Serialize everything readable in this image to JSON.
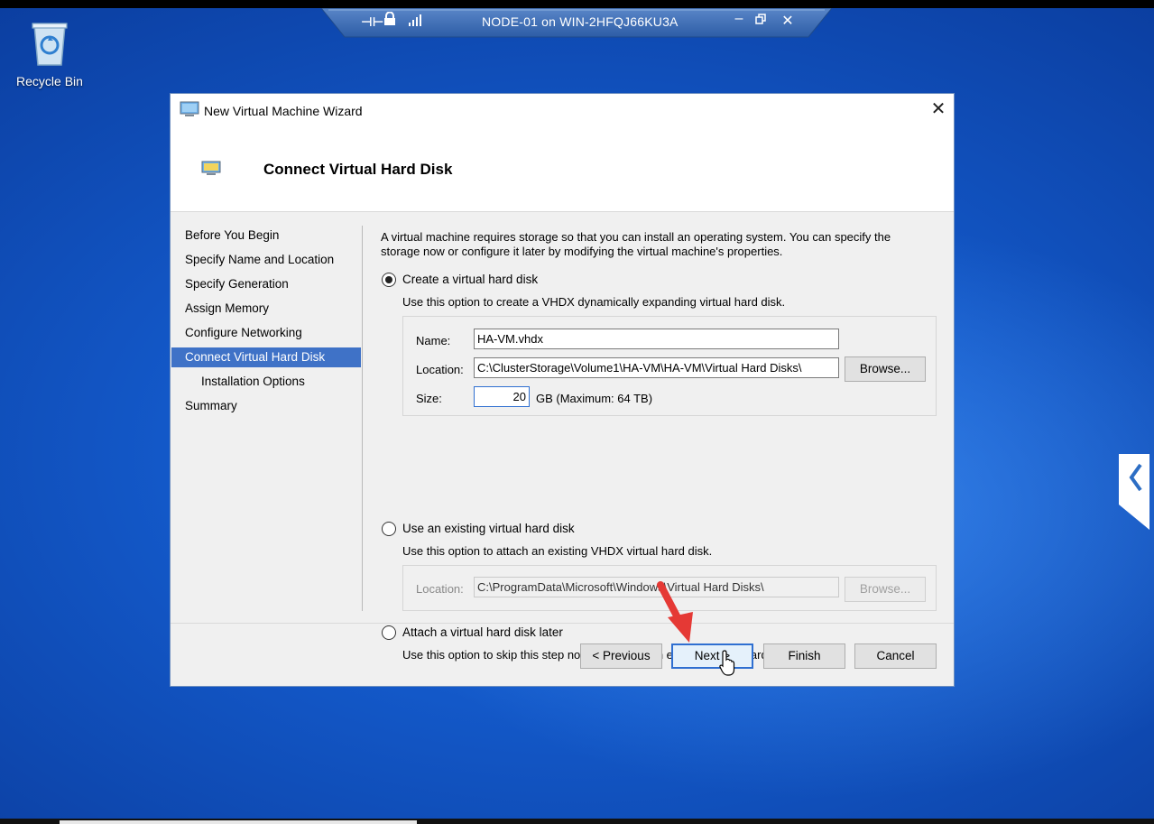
{
  "desktop": {
    "recycle_bin_label": "Recycle Bin"
  },
  "rdp_bar": {
    "title": "NODE-01 on WIN-2HFQJ66KU3A",
    "pin_glyph": "⊣⊢",
    "minimize_glyph": "–",
    "close_glyph": "✕"
  },
  "wizard": {
    "title": "New Virtual Machine Wizard",
    "close_glyph": "✕",
    "header_title": "Connect Virtual Hard Disk",
    "nav": [
      {
        "label": "Before You Begin"
      },
      {
        "label": "Specify Name and Location"
      },
      {
        "label": "Specify Generation"
      },
      {
        "label": "Assign Memory"
      },
      {
        "label": "Configure Networking"
      },
      {
        "label": "Connect Virtual Hard Disk",
        "selected": true
      },
      {
        "label": "Installation Options",
        "sub": true
      },
      {
        "label": "Summary"
      }
    ],
    "intro": "A virtual machine requires storage so that you can install an operating system. You can specify the storage now or configure it later by modifying the virtual machine's properties.",
    "option_create": {
      "label": "Create a virtual hard disk",
      "description": "Use this option to create a VHDX dynamically expanding virtual hard disk.",
      "selected": true,
      "name_label": "Name:",
      "name_value": "HA-VM.vhdx",
      "location_label": "Location:",
      "location_value": "C:\\ClusterStorage\\Volume1\\HA-VM\\HA-VM\\Virtual Hard Disks\\",
      "browse_label": "Browse...",
      "size_label": "Size:",
      "size_value": "20",
      "size_unit": "GB (Maximum: 64 TB)"
    },
    "option_existing": {
      "label": "Use an existing virtual hard disk",
      "description": "Use this option to attach an existing VHDX virtual hard disk.",
      "selected": false,
      "location_label": "Location:",
      "location_value": "C:\\ProgramData\\Microsoft\\Windows\\Virtual Hard Disks\\",
      "browse_label": "Browse..."
    },
    "option_later": {
      "label": "Attach a virtual hard disk later",
      "description": "Use this option to skip this step now and attach an existing virtual hard disk later.",
      "selected": false
    },
    "buttons": {
      "previous": "< Previous",
      "next": "Next >",
      "finish": "Finish",
      "cancel": "Cancel"
    }
  },
  "colors": {
    "desktop_blue": "#1358c8",
    "nav_selected": "#3f72c7",
    "annotation_arrow": "#e53935"
  },
  "icons": {
    "recycle_bin": "recycle-bin-icon",
    "vm_wizard": "monitor-icon",
    "lock": "lock-icon",
    "signal": "signal-bars-icon",
    "side_tab": "chevron-left-icon",
    "cursor": "mouse-pointer-icon",
    "arrow": "red-arrow-icon"
  }
}
